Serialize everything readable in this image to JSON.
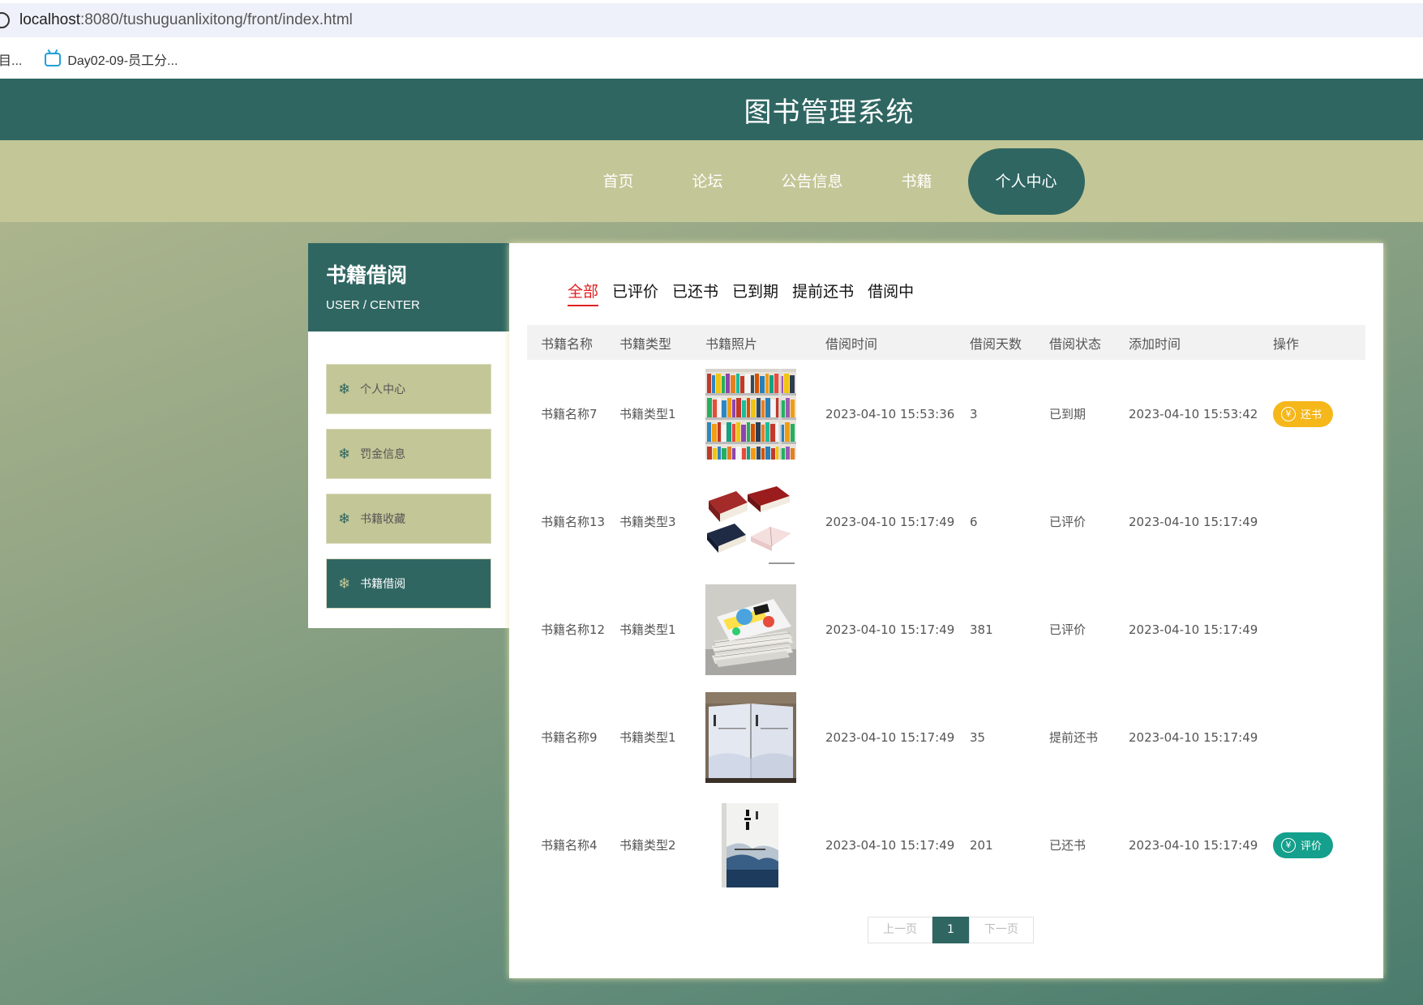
{
  "browser": {
    "address_host": "localhost",
    "address_rest": ":8080/tushuguanlixitong/front/index.html",
    "bookmarks": [
      "目...",
      "Day02-09-员工分..."
    ]
  },
  "site": {
    "title": "图书管理系统"
  },
  "nav": [
    "首页",
    "论坛",
    "公告信息",
    "书籍",
    "个人中心"
  ],
  "sidebar": {
    "title": "书籍借阅",
    "subtitle": "USER / CENTER",
    "items": [
      "个人中心",
      "罚金信息",
      "书籍收藏",
      "书籍借阅"
    ],
    "active_index": 3
  },
  "tabs": [
    "全部",
    "已评价",
    "已还书",
    "已到期",
    "提前还书",
    "借阅中"
  ],
  "active_tab": 0,
  "table": {
    "headers": [
      "书籍名称",
      "书籍类型",
      "书籍照片",
      "借阅时间",
      "借阅天数",
      "借阅状态",
      "添加时间",
      "操作"
    ],
    "rows": [
      {
        "name": "书籍名称7",
        "type": "书籍类型1",
        "photo": "bookshelf-photo",
        "borrow_time": "2023-04-10 15:53:36",
        "days": "3",
        "status": "已到期",
        "add_time": "2023-04-10 15:53:42",
        "action": "还书",
        "action_kind": "return"
      },
      {
        "name": "书籍名称13",
        "type": "书籍类型3",
        "photo": "hardcover-books-photo",
        "borrow_time": "2023-04-10 15:17:49",
        "days": "6",
        "status": "已评价",
        "add_time": "2023-04-10 15:17:49",
        "action": "",
        "action_kind": ""
      },
      {
        "name": "书籍名称12",
        "type": "书籍类型1",
        "photo": "book-stack-photo",
        "borrow_time": "2023-04-10 15:17:49",
        "days": "381",
        "status": "已评价",
        "add_time": "2023-04-10 15:17:49",
        "action": "",
        "action_kind": ""
      },
      {
        "name": "书籍名称9",
        "type": "书籍类型1",
        "photo": "boxed-set-photo",
        "borrow_time": "2023-04-10 15:17:49",
        "days": "35",
        "status": "提前还书",
        "add_time": "2023-04-10 15:17:49",
        "action": "",
        "action_kind": ""
      },
      {
        "name": "书籍名称4",
        "type": "书籍类型2",
        "photo": "huozhe-cover-photo",
        "borrow_time": "2023-04-10 15:17:49",
        "days": "201",
        "status": "已还书",
        "add_time": "2023-04-10 15:17:49",
        "action": "评价",
        "action_kind": "review"
      }
    ]
  },
  "pager": {
    "prev": "上一页",
    "current": "1",
    "next": "下一页"
  },
  "colors": {
    "primary": "#2f6662",
    "nav_bg": "#c3c696",
    "active_tab": "#e02020",
    "return_btn": "#f5b71a",
    "review_btn": "#14a08c"
  }
}
